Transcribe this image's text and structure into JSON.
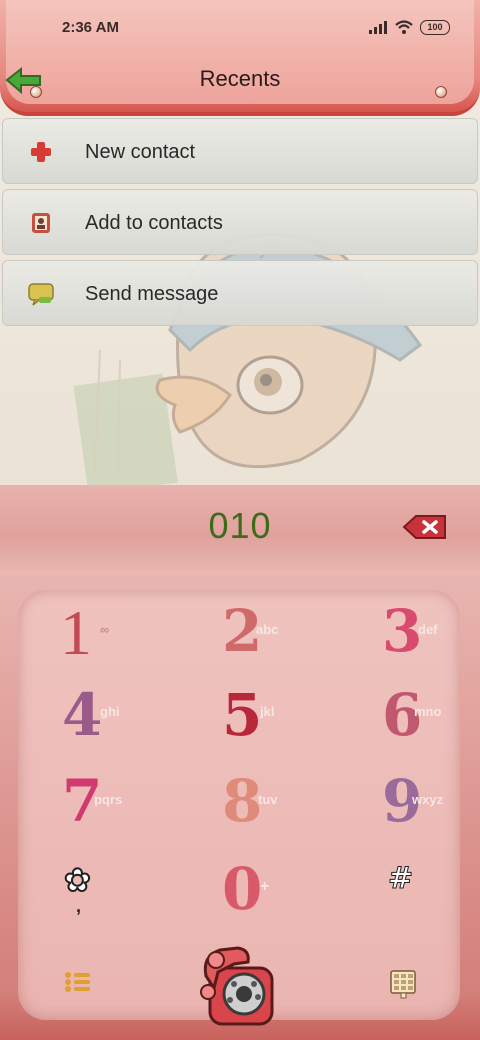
{
  "status_bar": {
    "time": "2:36 AM",
    "battery": "100"
  },
  "header": {
    "title": "Recents"
  },
  "menu": [
    {
      "label": "New contact",
      "icon": "plus-icon"
    },
    {
      "label": "Add to contacts",
      "icon": "contact-card-icon"
    },
    {
      "label": "Send message",
      "icon": "message-icon"
    }
  ],
  "dialer": {
    "number": "010"
  },
  "keypad": {
    "keys": [
      {
        "digit": "1",
        "letters": "∞"
      },
      {
        "digit": "2",
        "letters": "abc"
      },
      {
        "digit": "3",
        "letters": "def"
      },
      {
        "digit": "4",
        "letters": "ghi"
      },
      {
        "digit": "5",
        "letters": "jkl"
      },
      {
        "digit": "6",
        "letters": "mno"
      },
      {
        "digit": "7",
        "letters": "pqrs"
      },
      {
        "digit": "8",
        "letters": "tuv"
      },
      {
        "digit": "9",
        "letters": "wxyz"
      },
      {
        "digit": "✿",
        "letters": ","
      },
      {
        "digit": "0",
        "letters": "+"
      },
      {
        "digit": "#",
        "letters": ""
      }
    ]
  },
  "colors": {
    "header": "#e6877f",
    "number": "#3e6a1e",
    "keypad": "#f1c8c4"
  }
}
